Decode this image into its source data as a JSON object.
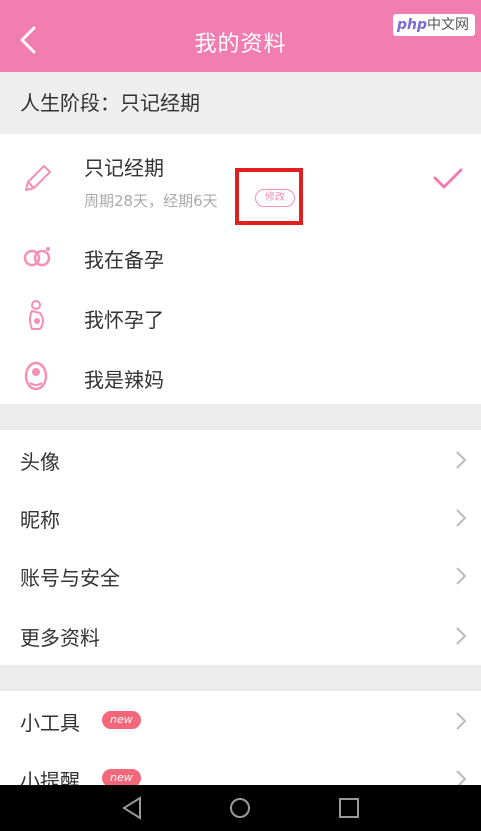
{
  "header": {
    "title": "我的资料"
  },
  "watermark": {
    "php": "php",
    "cn": "中文网"
  },
  "stage_section": {
    "heading": "人生阶段：只记经期",
    "items": [
      {
        "label": "只记经期",
        "sub": "周期28天，经期6天",
        "edit": "修改",
        "selected": true
      },
      {
        "label": "我在备孕"
      },
      {
        "label": "我怀孕了"
      },
      {
        "label": "我是辣妈"
      }
    ]
  },
  "profile_menu": [
    {
      "label": "头像"
    },
    {
      "label": "昵称"
    },
    {
      "label": "账号与安全"
    },
    {
      "label": "更多资料"
    }
  ],
  "tools_menu": [
    {
      "label": "小工具",
      "badge": "new"
    },
    {
      "label": "小提醒",
      "badge": "new"
    }
  ],
  "colors": {
    "brand": "#f27db1",
    "accent": "#f48fb6",
    "badge": "#f2687a",
    "highlight": "#e0201f"
  }
}
